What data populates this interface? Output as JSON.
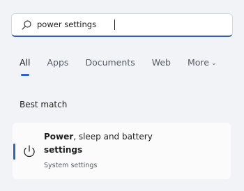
{
  "search": {
    "query": "power settings"
  },
  "tabs": [
    {
      "label": "All"
    },
    {
      "label": "Apps"
    },
    {
      "label": "Documents"
    },
    {
      "label": "Web"
    },
    {
      "label": "More"
    }
  ],
  "best_match": {
    "heading": "Best match",
    "result": {
      "title_bold": "Power",
      "title_rest": ", sleep and battery",
      "title_line2": "settings",
      "subtitle": "System settings",
      "icon": "power-icon"
    }
  },
  "colors": {
    "accent": "#2a64c4",
    "background": "#f2f3f7",
    "card": "#fbfbfc"
  }
}
